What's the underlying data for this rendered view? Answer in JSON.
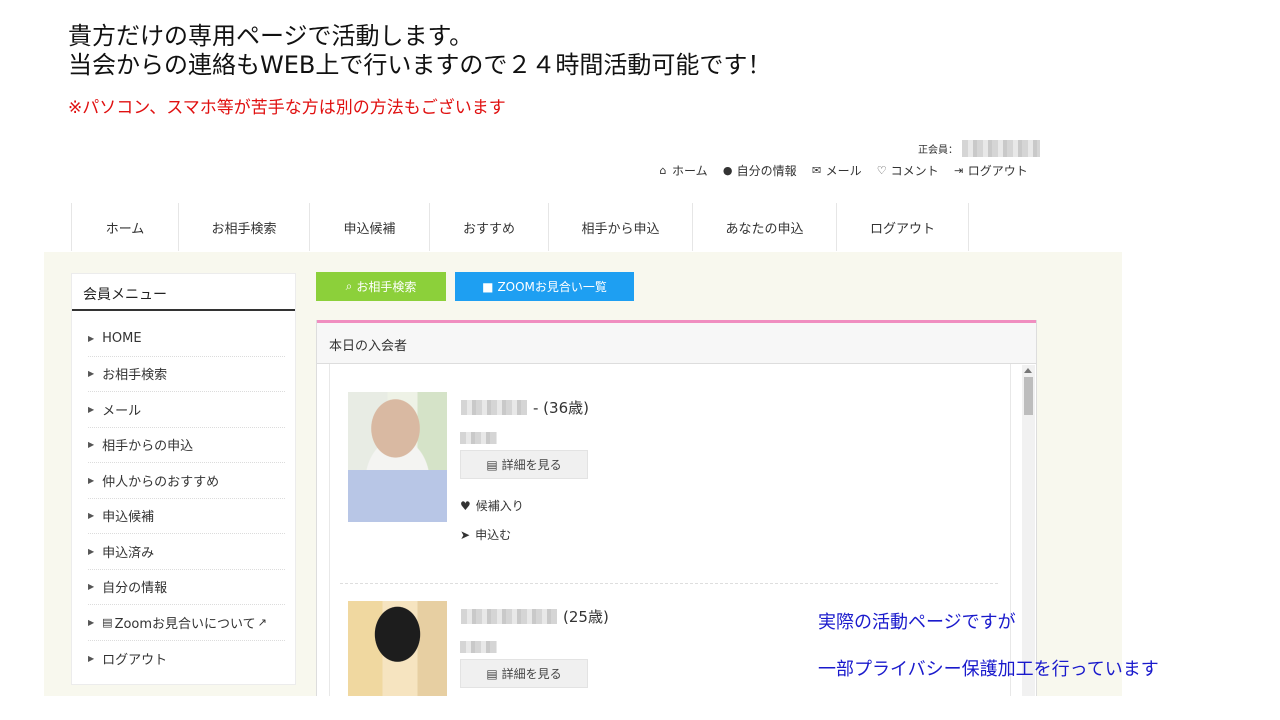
{
  "intro": {
    "line1": "貴方だけの専用ページで活動します。",
    "line2": "当会からの連絡もWEB上で行いますので２４時間活動可能です！",
    "note": "※パソコン、スマホ等が苦手な方は別の方法もございます"
  },
  "member": {
    "label": "正会員："
  },
  "toplinks": [
    {
      "icon": "home-icon",
      "glyph": "⌂",
      "label": "ホーム"
    },
    {
      "icon": "user-icon",
      "glyph": "●",
      "label": "自分の情報"
    },
    {
      "icon": "mail-icon",
      "glyph": "✉",
      "label": "メール"
    },
    {
      "icon": "heart-outline-icon",
      "glyph": "♡",
      "label": "コメント"
    },
    {
      "icon": "logout-icon",
      "glyph": "⇥",
      "label": "ログアウト"
    }
  ],
  "nav": [
    {
      "label": "ホーム"
    },
    {
      "label": "お相手検索"
    },
    {
      "label": "申込候補"
    },
    {
      "label": "おすすめ"
    },
    {
      "label": "相手から申込"
    },
    {
      "label": "あなたの申込"
    },
    {
      "label": "ログアウト"
    }
  ],
  "sidebar": {
    "title": "会員メニュー",
    "items": [
      {
        "label": "HOME"
      },
      {
        "label": "お相手検索"
      },
      {
        "label": "メール"
      },
      {
        "label": "相手からの申込"
      },
      {
        "label": "仲人からのおすすめ"
      },
      {
        "label": "申込候補"
      },
      {
        "label": "申込済み"
      },
      {
        "label": "自分の情報"
      },
      {
        "label": "Zoomお見合いについて"
      },
      {
        "label": "ログアウト"
      }
    ]
  },
  "actions": {
    "search_label": "お相手検索",
    "zoom_label": "ZOOMお見合い一覧"
  },
  "panel": {
    "title": "本日の入会者"
  },
  "profiles": [
    {
      "age": "- (36歳)",
      "detail_label": "詳細を見る",
      "favorite_label": "候補入り",
      "apply_label": "申込む"
    },
    {
      "age": "(25歳)",
      "detail_label": "詳細を見る"
    }
  ],
  "captions": {
    "line1": "実際の活動ページですが",
    "line2": "一部プライバシー保護加工を行っています"
  },
  "colors": {
    "search_button": "#8cd03a",
    "zoom_button": "#1e9ff2",
    "panel_accent": "#f08ec0",
    "note_text": "#e01010",
    "caption_text": "#1a1acc"
  }
}
